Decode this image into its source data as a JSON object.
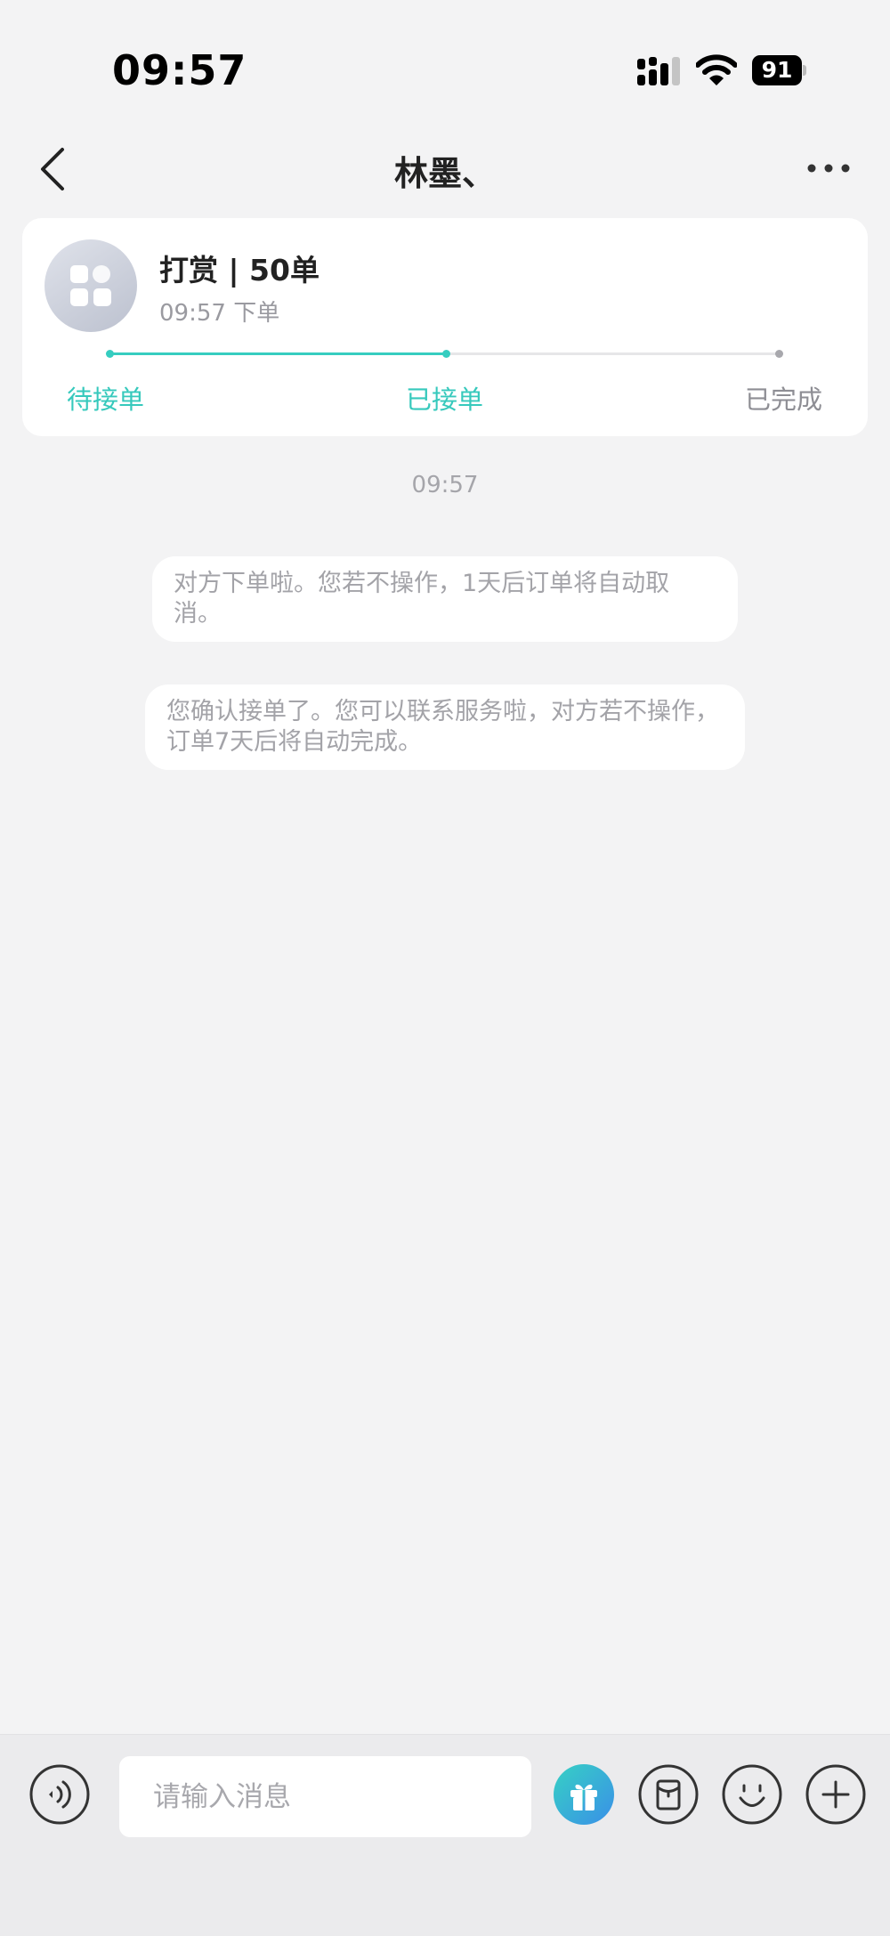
{
  "status_bar": {
    "time": "09:57",
    "battery": "91"
  },
  "nav": {
    "title": "林墨、"
  },
  "order": {
    "title": "打赏 | 50单",
    "time": "09:57 下单",
    "progress_fraction": 0.5,
    "steps": [
      {
        "label": "待接单",
        "state": "done"
      },
      {
        "label": "已接单",
        "state": "current"
      },
      {
        "label": "已完成",
        "state": "pending"
      }
    ]
  },
  "chat": {
    "timestamp": "09:57",
    "system_messages": [
      "对方下单啦。您若不操作，1天后订单将自动取消。",
      "您确认接单了。您可以联系服务啦，对方若不操作，订单7天后将自动完成。"
    ]
  },
  "composer": {
    "placeholder": "请输入消息"
  },
  "colors": {
    "accent": "#36cdc0",
    "gift_gradient_start": "#36d1c4",
    "gift_gradient_end": "#3a8fe8",
    "background": "#f3f3f4"
  },
  "icons": [
    "back-icon",
    "more-icon",
    "signal-icon",
    "wifi-icon",
    "battery-icon",
    "apps-icon",
    "voice-icon",
    "gift-icon",
    "red-packet-icon",
    "emoji-icon",
    "plus-icon"
  ]
}
